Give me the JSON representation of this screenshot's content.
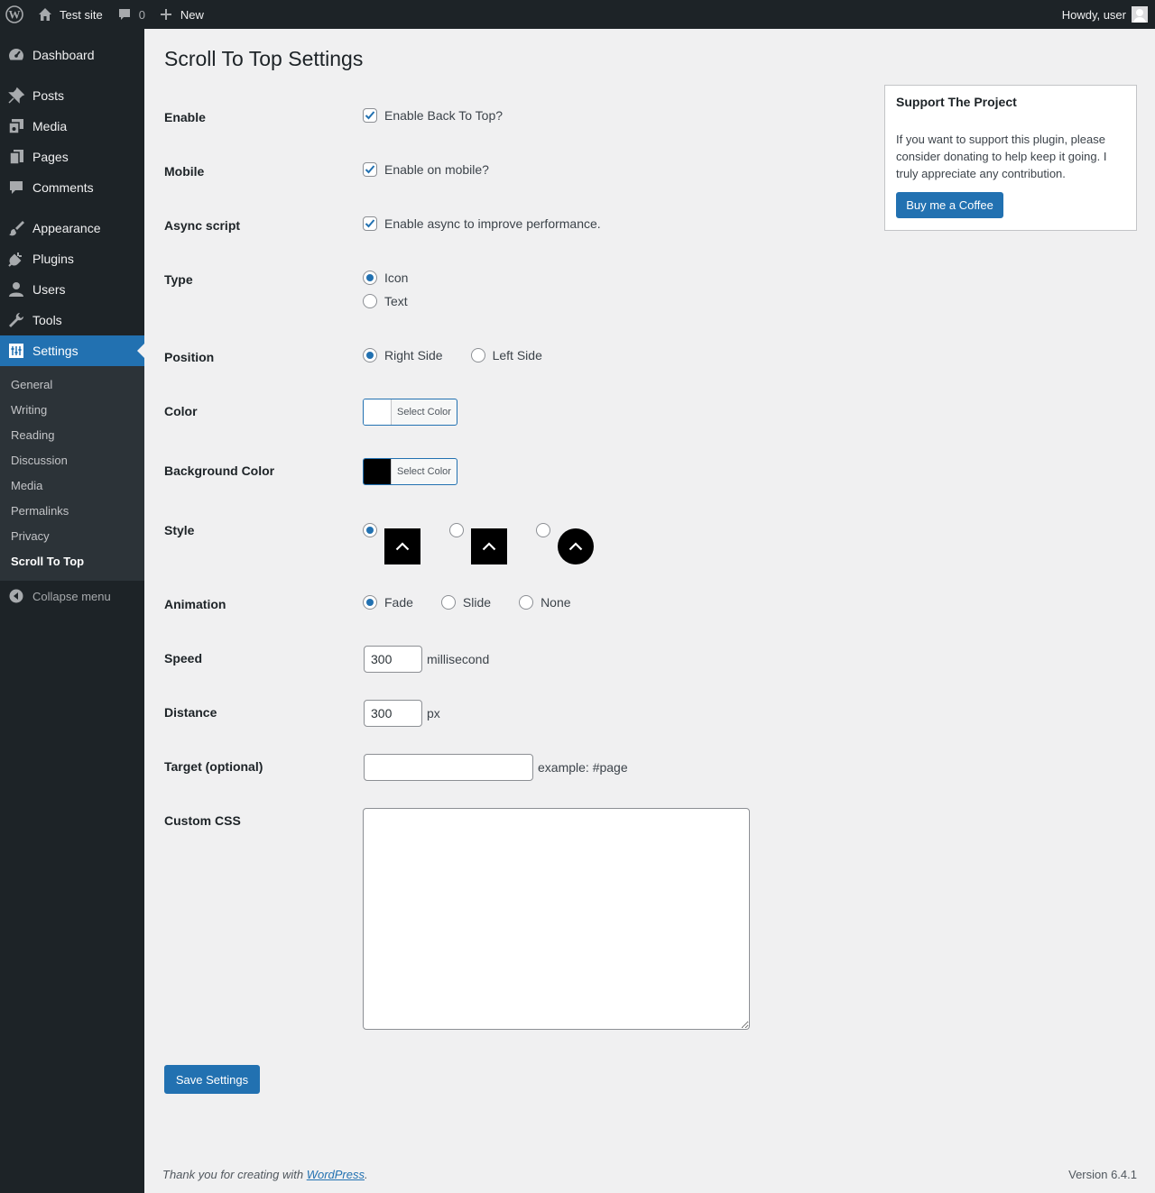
{
  "adminbar": {
    "site_name": "Test site",
    "comment_count": "0",
    "new_label": "New",
    "howdy": "Howdy, user"
  },
  "menu": {
    "dashboard": "Dashboard",
    "posts": "Posts",
    "media": "Media",
    "pages": "Pages",
    "comments": "Comments",
    "appearance": "Appearance",
    "plugins": "Plugins",
    "users": "Users",
    "tools": "Tools",
    "settings": "Settings",
    "collapse": "Collapse menu"
  },
  "submenu": [
    "General",
    "Writing",
    "Reading",
    "Discussion",
    "Media",
    "Permalinks",
    "Privacy",
    "Scroll To Top"
  ],
  "page": {
    "title": "Scroll To Top Settings"
  },
  "fields": {
    "enable": {
      "label": "Enable",
      "text": "Enable Back To Top?",
      "checked": true
    },
    "mobile": {
      "label": "Mobile",
      "text": "Enable on mobile?",
      "checked": true
    },
    "async": {
      "label": "Async script",
      "text": "Enable async to improve performance.",
      "checked": true
    },
    "type": {
      "label": "Type",
      "options": [
        "Icon",
        "Text"
      ],
      "selected": "Icon"
    },
    "position": {
      "label": "Position",
      "options": [
        "Right Side",
        "Left Side"
      ],
      "selected": "Right Side"
    },
    "color": {
      "label": "Color",
      "button": "Select Color",
      "value": "#ffffff"
    },
    "bg_color": {
      "label": "Background Color",
      "button": "Select Color",
      "value": "#000000"
    },
    "style": {
      "label": "Style",
      "selected_index": 0
    },
    "animation": {
      "label": "Animation",
      "options": [
        "Fade",
        "Slide",
        "None"
      ],
      "selected": "Fade"
    },
    "speed": {
      "label": "Speed",
      "value": "300",
      "suffix": "millisecond"
    },
    "distance": {
      "label": "Distance",
      "value": "300",
      "suffix": "px"
    },
    "target": {
      "label": "Target (optional)",
      "value": "",
      "hint": "example: #page"
    },
    "custom_css": {
      "label": "Custom CSS",
      "value": ""
    }
  },
  "save_label": "Save Settings",
  "support": {
    "title": "Support The Project",
    "text": "If you want to support this plugin, please consider donating to help keep it going. I truly appreciate any contribution.",
    "button": "Buy me a Coffee"
  },
  "footer": {
    "thanks_prefix": "Thank you for creating with ",
    "link": "WordPress",
    "thanks_suffix": ".",
    "version": "Version 6.4.1"
  },
  "colors": {
    "accent": "#2271b1",
    "sidebar_bg": "#1d2327",
    "submenu_bg": "#2c3338",
    "page_bg": "#f0f0f1"
  }
}
